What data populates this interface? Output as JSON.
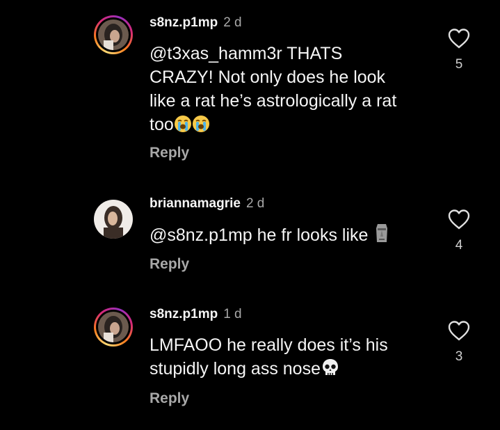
{
  "comments": [
    {
      "username": "s8nz.p1mp",
      "time": "2 d",
      "mention": "@t3xas_hamm3r",
      "lines": [
        "THATS",
        "CRAZY! Not only does he look",
        "like a rat he’s astrologically a rat",
        "too"
      ],
      "trailing_emojis": [
        "loudly-crying-face",
        "loudly-crying-face"
      ],
      "reply_label": "Reply",
      "likes": "5",
      "has_story_ring": true
    },
    {
      "username": "briannamagrie",
      "time": "2 d",
      "mention": "@s8nz.p1mp",
      "text": "he fr looks like",
      "trailing_emojis": [
        "moai"
      ],
      "reply_label": "Reply",
      "likes": "4",
      "has_story_ring": false
    },
    {
      "username": "s8nz.p1mp",
      "time": "1 d",
      "lines": [
        "LMFAOO he really does it’s his",
        "stupidly long ass nose"
      ],
      "trailing_emojis": [
        "skull"
      ],
      "reply_label": "Reply",
      "likes": "3",
      "has_story_ring": true
    }
  ],
  "icons": {
    "like": "heart-outline-icon"
  },
  "colors": {
    "background": "#000000",
    "primary_text": "#f5f5f5",
    "secondary_text": "#a8a8a8"
  }
}
